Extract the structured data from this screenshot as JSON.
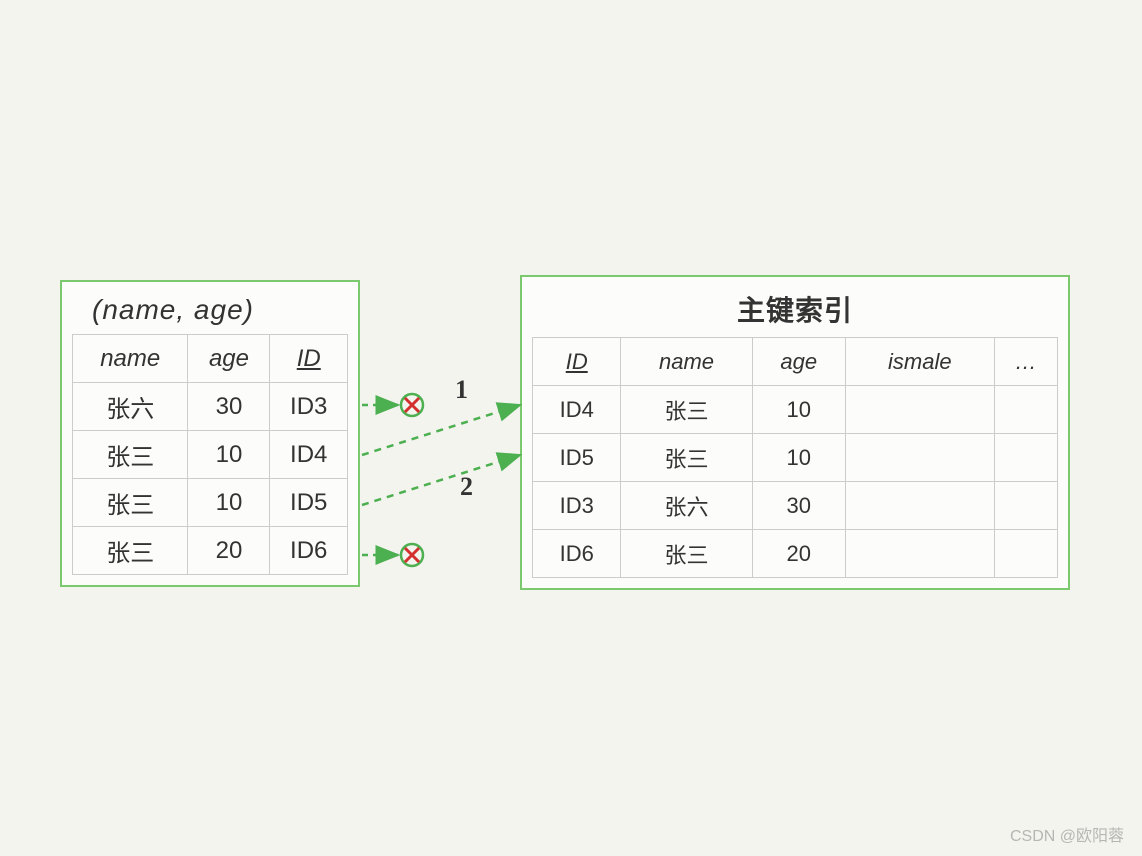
{
  "left": {
    "title": "(name, age)",
    "headers": [
      "name",
      "age",
      "ID"
    ],
    "rows": [
      {
        "name": "张六",
        "age": "30",
        "id": "ID3"
      },
      {
        "name": "张三",
        "age": "10",
        "id": "ID4"
      },
      {
        "name": "张三",
        "age": "10",
        "id": "ID5"
      },
      {
        "name": "张三",
        "age": "20",
        "id": "ID6"
      }
    ]
  },
  "right": {
    "title": "主键索引",
    "headers": [
      "ID",
      "name",
      "age",
      "ismale",
      "…"
    ],
    "rows": [
      {
        "id": "ID4",
        "name": "张三",
        "age": "10",
        "ismale": "",
        "more": ""
      },
      {
        "id": "ID5",
        "name": "张三",
        "age": "10",
        "ismale": "",
        "more": ""
      },
      {
        "id": "ID3",
        "name": "张六",
        "age": "30",
        "ismale": "",
        "more": ""
      },
      {
        "id": "ID6",
        "name": "张三",
        "age": "20",
        "ismale": "",
        "more": ""
      }
    ]
  },
  "arrows": {
    "label1": "1",
    "label2": "2"
  },
  "watermark": "CSDN @欧阳蓉"
}
